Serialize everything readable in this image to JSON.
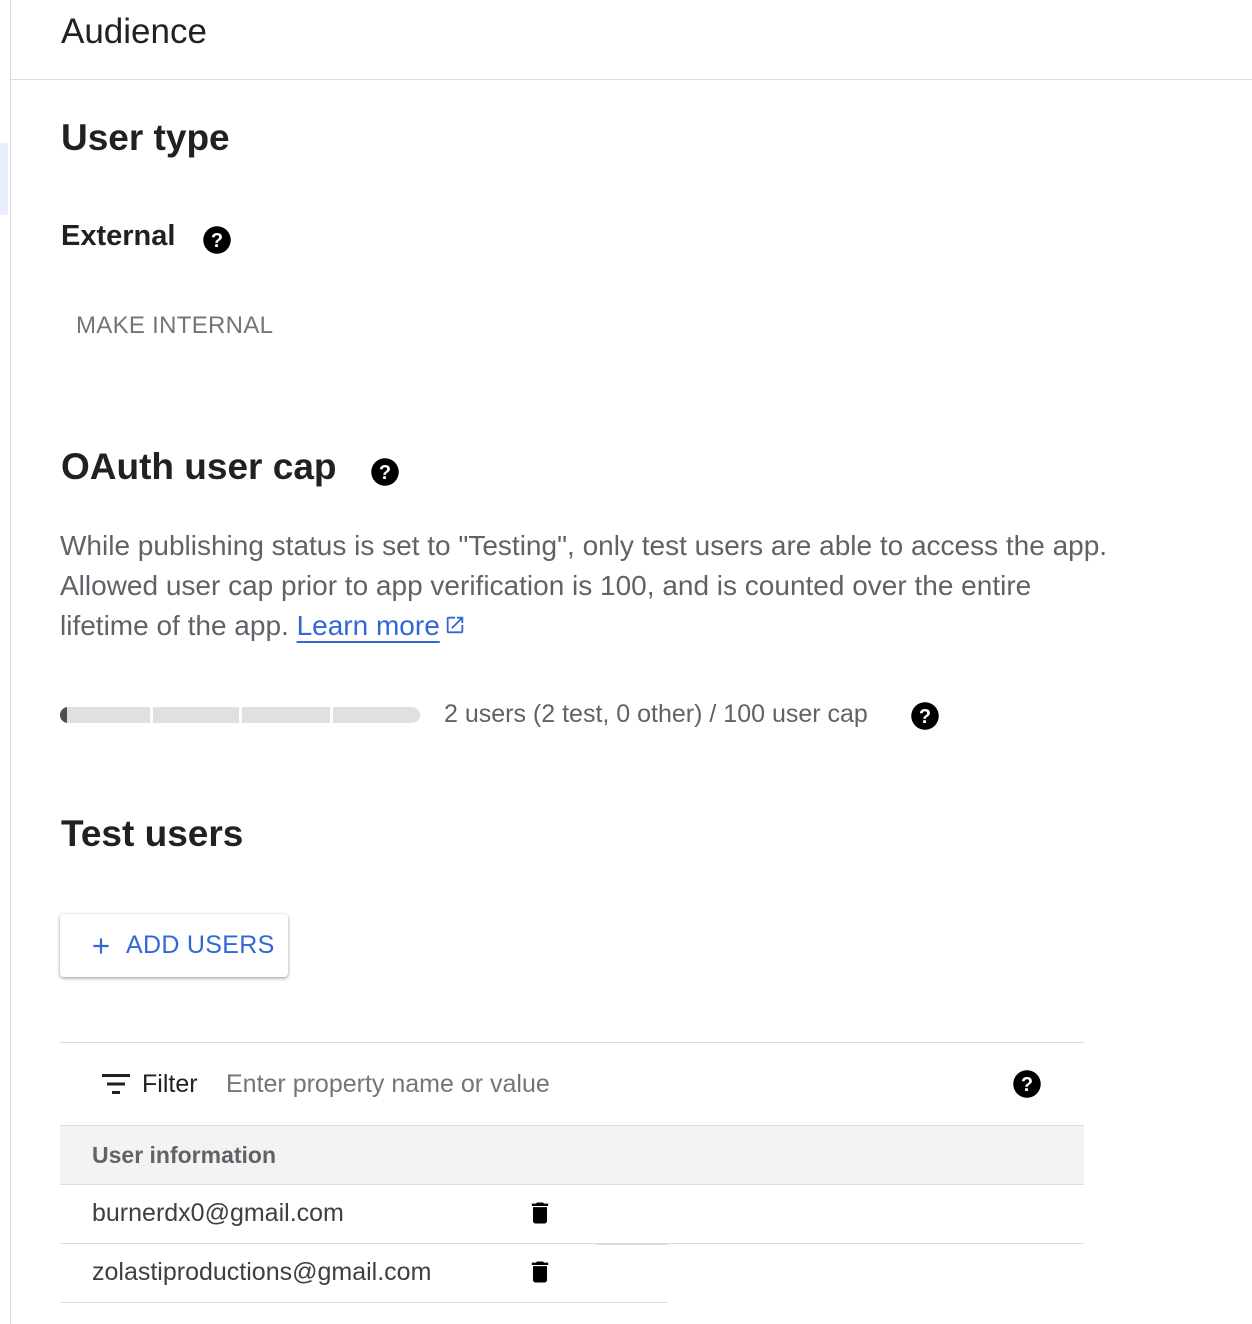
{
  "header": {
    "title": "Audience"
  },
  "user_type": {
    "heading": "User type",
    "value": "External",
    "make_internal_label": "MAKE INTERNAL"
  },
  "oauth_cap": {
    "heading": "OAuth user cap",
    "description": "While publishing status is set to \"Testing\", only test users are able to access the app. Allowed user cap prior to app verification is 100, and is counted over the entire lifetime of the app. ",
    "learn_more": "Learn more",
    "usage_text": "2 users (2 test, 0 other) / 100 user cap",
    "users": 2,
    "cap": 100,
    "segments": 4
  },
  "test_users": {
    "heading": "Test users",
    "add_users_label": "ADD USERS",
    "filter_label": "Filter",
    "filter_placeholder": "Enter property name or value",
    "column_header": "User information",
    "rows": [
      {
        "email": "burnerdx0@gmail.com"
      },
      {
        "email": "zolastiproductions@gmail.com"
      }
    ]
  },
  "colors": {
    "link": "#3367d6",
    "progress_fill": "#4a4f55",
    "progress_track": "#e0e0e0"
  }
}
